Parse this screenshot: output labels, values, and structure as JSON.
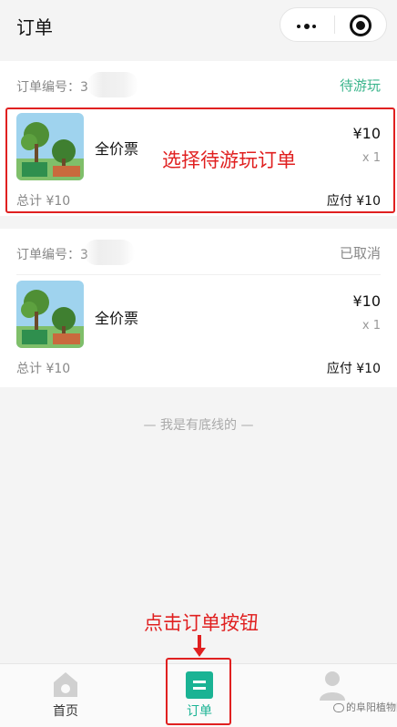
{
  "titlebar": {
    "title": "订单",
    "menu_icon": "more-dots-icon",
    "close_icon": "target-circle-icon"
  },
  "orders": [
    {
      "order_no_label": "订单编号：3",
      "status": "待游玩",
      "status_color": "#3bb58c",
      "product_name": "全价票",
      "price": "¥10",
      "quantity": "x 1",
      "total": "总计 ¥10",
      "payable": "应付 ¥10"
    },
    {
      "order_no_label": "订单编号：3",
      "status": "已取消",
      "status_color": "#888888",
      "product_name": "全价票",
      "price": "¥10",
      "quantity": "x 1",
      "total": "总计 ¥10",
      "payable": "应付 ¥10"
    }
  ],
  "annotations": {
    "select_order": "选择待游玩订单",
    "click_order_tab": "点击订单按钮",
    "color": "#e02020"
  },
  "end_text": "— 我是有底线的 —",
  "tabs": [
    {
      "label": "首页",
      "icon": "home-icon",
      "active": false
    },
    {
      "label": "订单",
      "icon": "order-list-icon",
      "active": true
    },
    {
      "label": "",
      "icon": "user-icon",
      "active": false
    }
  ],
  "watermark": "的阜阳植物园",
  "accent_color": "#1ab394"
}
